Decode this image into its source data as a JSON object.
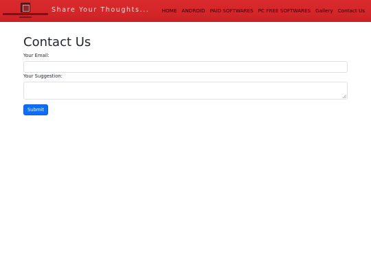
{
  "navbar": {
    "tagline": "Share Your Thoughts...",
    "links": [
      {
        "label": "HOME"
      },
      {
        "label": "ANDROID"
      },
      {
        "label": "PAID SOFTWARES"
      },
      {
        "label": "PC FREE SOFTWARES"
      },
      {
        "label": "Gallery"
      },
      {
        "label": "Contact Us"
      }
    ],
    "background_color": "#d42628"
  },
  "form": {
    "title": "Contact Us",
    "email_label": "Your Email:",
    "email_value": "",
    "suggestion_label": "Your Suggestion:",
    "suggestion_value": "",
    "submit_label": "Submit",
    "submit_color": "#0d6efd"
  }
}
